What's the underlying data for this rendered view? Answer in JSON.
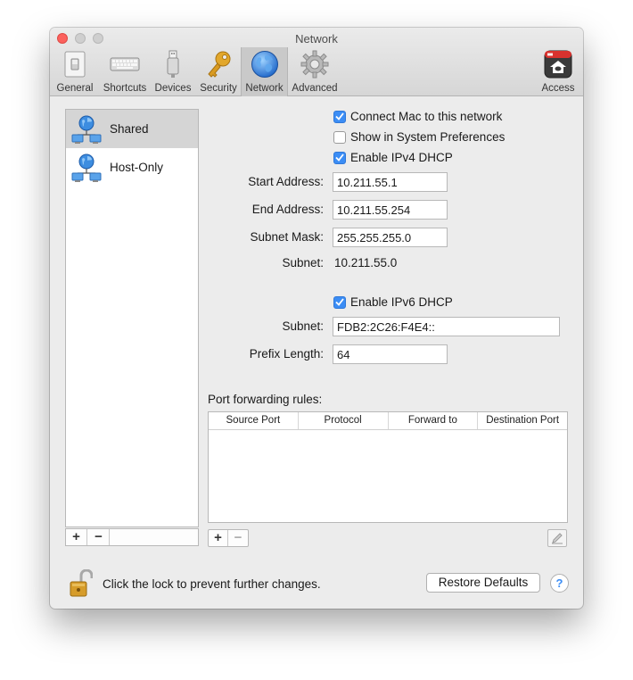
{
  "window": {
    "title": "Network"
  },
  "toolbar": {
    "items": [
      {
        "label": "General",
        "icon": "general-icon"
      },
      {
        "label": "Shortcuts",
        "icon": "keyboard-icon"
      },
      {
        "label": "Devices",
        "icon": "usb-icon"
      },
      {
        "label": "Security",
        "icon": "key-icon"
      },
      {
        "label": "Network",
        "icon": "globe-icon",
        "selected": true
      },
      {
        "label": "Advanced",
        "icon": "gear-icon"
      }
    ],
    "access": {
      "label": "Access",
      "icon": "parallels-access-icon"
    }
  },
  "sidebar": {
    "items": [
      {
        "label": "Shared",
        "selected": true,
        "icon": "network-icon"
      },
      {
        "label": "Host-Only",
        "selected": false,
        "icon": "network-icon"
      }
    ],
    "add_label": "+",
    "remove_label": "−"
  },
  "options": {
    "connect_mac": {
      "label": "Connect Mac to this network",
      "checked": true
    },
    "show_in_prefs": {
      "label": "Show in System Preferences",
      "checked": false
    },
    "ipv4_dhcp": {
      "label": "Enable IPv4 DHCP",
      "checked": true
    },
    "ipv6_dhcp": {
      "label": "Enable IPv6 DHCP",
      "checked": true
    }
  },
  "ipv4": {
    "start_label": "Start Address:",
    "start_value": "10.211.55.1",
    "end_label": "End Address:",
    "end_value": "10.211.55.254",
    "mask_label": "Subnet Mask:",
    "mask_value": "255.255.255.0",
    "subnet_label": "Subnet:",
    "subnet_value": "10.211.55.0"
  },
  "ipv6": {
    "subnet_label": "Subnet:",
    "subnet_value": "FDB2:2C26:F4E4::",
    "prefix_label": "Prefix Length:",
    "prefix_value": "64"
  },
  "port_forwarding": {
    "title": "Port forwarding rules:",
    "columns": [
      "Source Port",
      "Protocol",
      "Forward to",
      "Destination Port"
    ],
    "rows": [],
    "add_label": "+",
    "remove_label": "−"
  },
  "footer": {
    "lock_text": "Click the lock to prevent further changes.",
    "restore_label": "Restore Defaults",
    "help_label": "?"
  },
  "colors": {
    "accent": "#3b8df5",
    "close": "#fc615d"
  }
}
